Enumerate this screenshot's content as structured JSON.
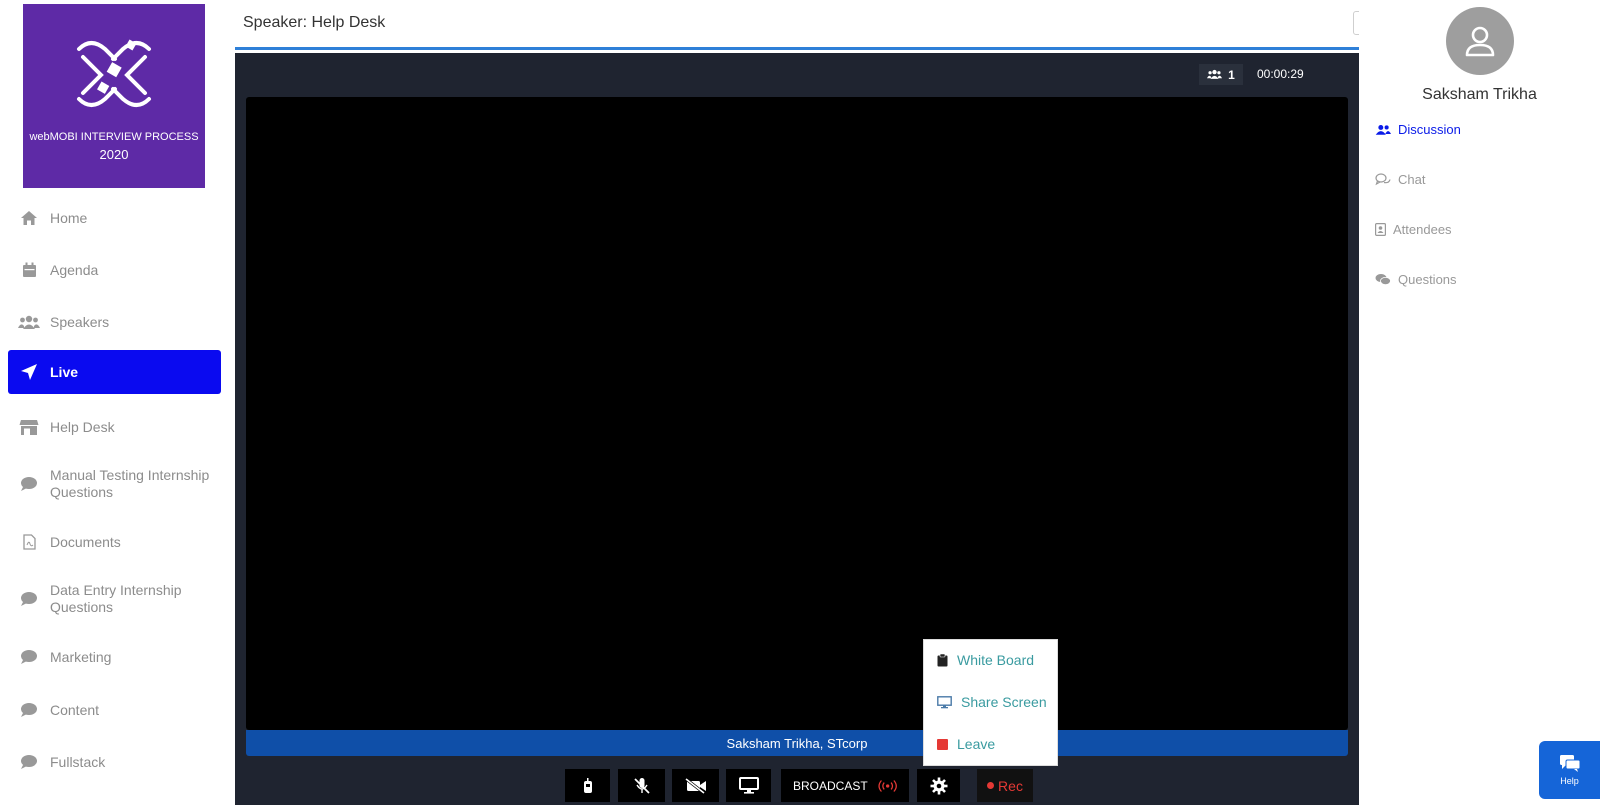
{
  "logo": {
    "name": "webMOBI INTERVIEW PROCESS",
    "year": "2020"
  },
  "sidebar": {
    "items": [
      {
        "label": "Home",
        "icon": "home-icon"
      },
      {
        "label": "Agenda",
        "icon": "calendar-icon"
      },
      {
        "label": "Speakers",
        "icon": "users-icon"
      },
      {
        "label": "Live",
        "icon": "paper-plane-icon",
        "active": true
      },
      {
        "label": "Help Desk",
        "icon": "store-icon"
      },
      {
        "label": "Manual Testing Internship Questions",
        "icon": "comment-icon"
      },
      {
        "label": "Documents",
        "icon": "pdf-file-icon"
      },
      {
        "label": "Data Entry Internship Questions",
        "icon": "comment-icon"
      },
      {
        "label": "Marketing",
        "icon": "comment-icon"
      },
      {
        "label": "Content",
        "icon": "comment-icon"
      },
      {
        "label": "Fullstack",
        "icon": "comment-icon"
      }
    ]
  },
  "header": {
    "title": "Speaker: Help Desk"
  },
  "stage": {
    "participants": "1",
    "timer": "00:00:29",
    "name_bar": "Saksham Trikha, STcorp"
  },
  "controls": {
    "broadcast_label": "BROADCAST",
    "rec_label": "Rec"
  },
  "dropdown": {
    "items": [
      "White Board",
      "Share Screen",
      "Leave"
    ]
  },
  "profile": {
    "name": "Saksham Trikha"
  },
  "right_tabs": [
    "Discussion",
    "Chat",
    "Attendees",
    "Questions"
  ],
  "help": {
    "label": "Help"
  },
  "colors": {
    "accent": "#0a0af0",
    "logo_bg": "#5e2aa6",
    "name_bar": "#0f4fa8",
    "rec": "#e53935",
    "menu_text": "#3a9ba0"
  }
}
